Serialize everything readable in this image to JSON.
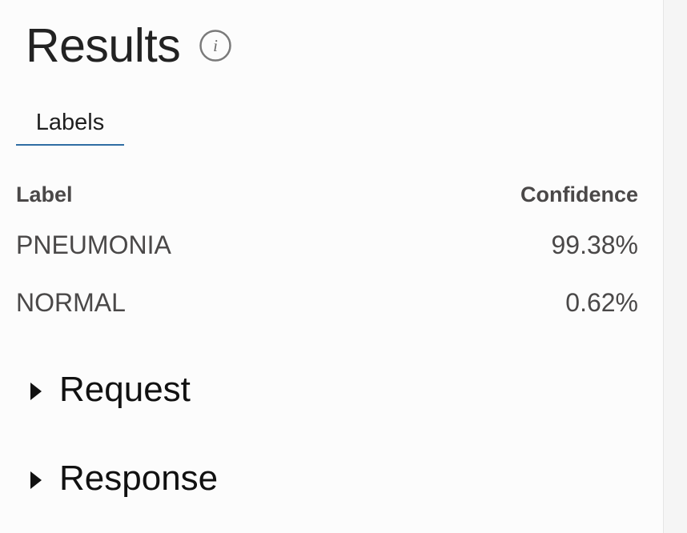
{
  "header": {
    "title": "Results",
    "info_icon": "info-icon"
  },
  "tabs": [
    {
      "label": "Labels",
      "active": true
    }
  ],
  "table": {
    "headers": {
      "label": "Label",
      "confidence": "Confidence"
    },
    "rows": [
      {
        "label": "PNEUMONIA",
        "confidence": "99.38%"
      },
      {
        "label": "NORMAL",
        "confidence": "0.62%"
      }
    ]
  },
  "sections": {
    "request": {
      "label": "Request",
      "icon": "chevron-right-icon"
    },
    "response": {
      "label": "Response",
      "icon": "chevron-right-icon"
    }
  },
  "colors": {
    "tab_underline": "#2f6da3",
    "text_primary": "#222222",
    "text_secondary": "#4a4848"
  }
}
